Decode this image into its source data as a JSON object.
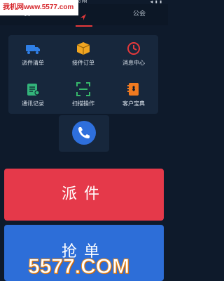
{
  "status_bar": {
    "time": "6:10 PM",
    "right": "◀ ▮ ▮"
  },
  "banner": {
    "text": "我机网www.5577.com"
  },
  "tabs": [
    {
      "label": "我"
    },
    {
      "label": "公会"
    }
  ],
  "grid": [
    {
      "label": "派件清单",
      "icon": "truck-icon",
      "color": "#2f7fe6"
    },
    {
      "label": "接件订单",
      "icon": "box-icon",
      "color": "#f0a521"
    },
    {
      "label": "消息中心",
      "icon": "clock-icon",
      "color": "#e5393b"
    },
    {
      "label": "通讯记录",
      "icon": "notepad-icon",
      "color": "#33b37a"
    },
    {
      "label": "扫描操作",
      "icon": "scan-icon",
      "color": "#37b86b"
    },
    {
      "label": "客户宝典",
      "icon": "contacts-book-icon",
      "color": "#f07a20"
    }
  ],
  "phone_icon": "phone-icon",
  "buttons": {
    "dispatch": "派件",
    "grab": "抢单"
  },
  "watermark": {
    "text": "5577.COM"
  },
  "colors": {
    "dispatch": "#e5394a",
    "grab": "#2d6ed8",
    "accent": "#e5393b"
  }
}
